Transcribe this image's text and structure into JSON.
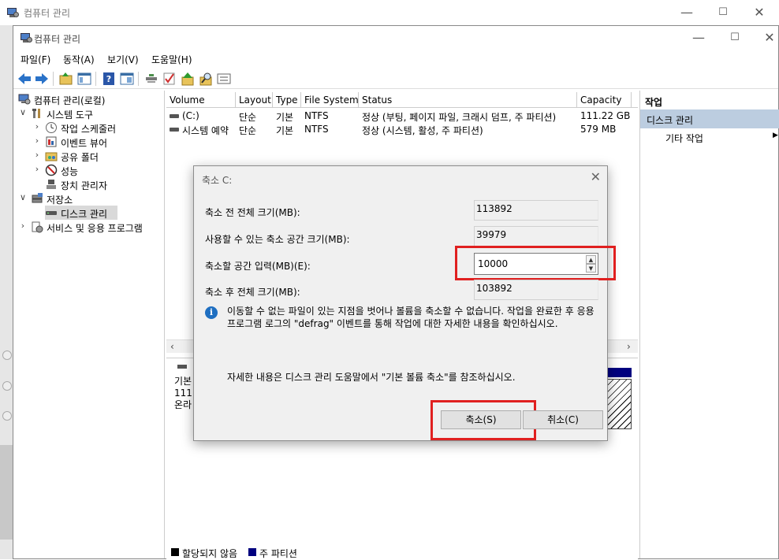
{
  "outer_window": {
    "title": "컴퓨터 관리"
  },
  "window": {
    "title": "컴퓨터 관리",
    "minimize": "—",
    "maximize": "☐",
    "close": "✕"
  },
  "menu": [
    "파일(F)",
    "동작(A)",
    "보기(V)",
    "도움말(H)"
  ],
  "toolbar_icons": [
    "back-icon",
    "forward-icon",
    "folder-up-icon",
    "show-hide-tree-icon",
    "help-icon",
    "properties-icon",
    "connect-icon",
    "check-icon",
    "up-arrow-icon",
    "search-icon",
    "options-icon"
  ],
  "tree": {
    "root": "컴퓨터 관리(로컬)",
    "system_tools": "시스템 도구",
    "task_scheduler": "작업 스케줄러",
    "event_viewer": "이벤트 뷰어",
    "shared_folders": "공유 폴더",
    "performance": "성능",
    "device_manager": "장치 관리자",
    "storage": "저장소",
    "disk_management": "디스크 관리",
    "services": "서비스 및 응용 프로그램"
  },
  "volume_table": {
    "headers": [
      "Volume",
      "Layout",
      "Type",
      "File System",
      "Status",
      "Capacity"
    ],
    "rows": [
      [
        "(C:)",
        "단순",
        "기본",
        "NTFS",
        "정상 (부팅, 페이지 파일, 크래시 덤프, 주 파티션)",
        "111.22 GB"
      ],
      [
        "시스템 예약",
        "단순",
        "기본",
        "NTFS",
        "정상 (시스템, 활성, 주 파티션)",
        "579 MB"
      ]
    ]
  },
  "disk_panel": {
    "line1": "기본",
    "line2": "111.",
    "line3": "온라"
  },
  "legend": {
    "unallocated": "할당되지 않음",
    "primary": "주 파티션"
  },
  "actions": {
    "header": "작업",
    "selected": "디스크 관리",
    "more": "기타 작업"
  },
  "dialog": {
    "title": "축소 C:",
    "total_before_label": "축소 전 전체 크기(MB):",
    "total_before_value": "113892",
    "available_label": "사용할 수 있는 축소 공간 크기(MB):",
    "available_value": "39979",
    "shrink_amount_label": "축소할 공간 입력(MB)(E):",
    "shrink_amount_value": "10000",
    "total_after_label": "축소 후 전체 크기(MB):",
    "total_after_value": "103892",
    "info_text": "이동할 수 없는 파일이 있는 지점을 벗어나 볼륨을 축소할 수 없습니다. 작업을 완료한 후 응용 프로그램 로그의 \"defrag\" 이벤트를 통해 작업에 대한 자세한 내용을 확인하십시오.",
    "reference_text": "자세한 내용은 디스크 관리 도움말에서 \"기본 볼륨 축소\"를 참조하십시오.",
    "shrink_button": "축소(S)",
    "cancel_button": "취소(C)"
  },
  "colors": {
    "highlight": "#e02020",
    "selection": "#bccde0",
    "primary_partition": "#00007f"
  }
}
